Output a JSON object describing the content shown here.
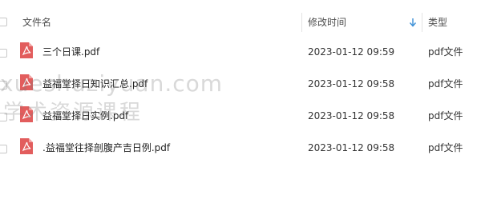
{
  "header": {
    "name_label": "文件名",
    "modified_label": "修改时间",
    "type_label": "类型"
  },
  "files": [
    {
      "name": "三个日课.pdf",
      "modified": "2023-01-12 09:59",
      "type": "pdf文件"
    },
    {
      "name": "益福堂择日知识汇总.pdf",
      "modified": "2023-01-12 09:58",
      "type": "pdf文件"
    },
    {
      "name": "益福堂择日实例.pdf",
      "modified": "2023-01-12 09:58",
      "type": "pdf文件"
    },
    {
      "name": ".益福堂往择剖腹产吉日例.pdf",
      "modified": "2023-01-12 09:58",
      "type": "pdf文件"
    }
  ],
  "watermark": {
    "line1": "xueshuziyuan.com",
    "line2": "学术资源课程"
  },
  "colors": {
    "pdf_red": "#e25d5d",
    "sort_arrow": "#3b8fd6"
  },
  "icons": {
    "file_icon": "pdf-file-icon",
    "sort": "sort-down-arrow-icon"
  }
}
